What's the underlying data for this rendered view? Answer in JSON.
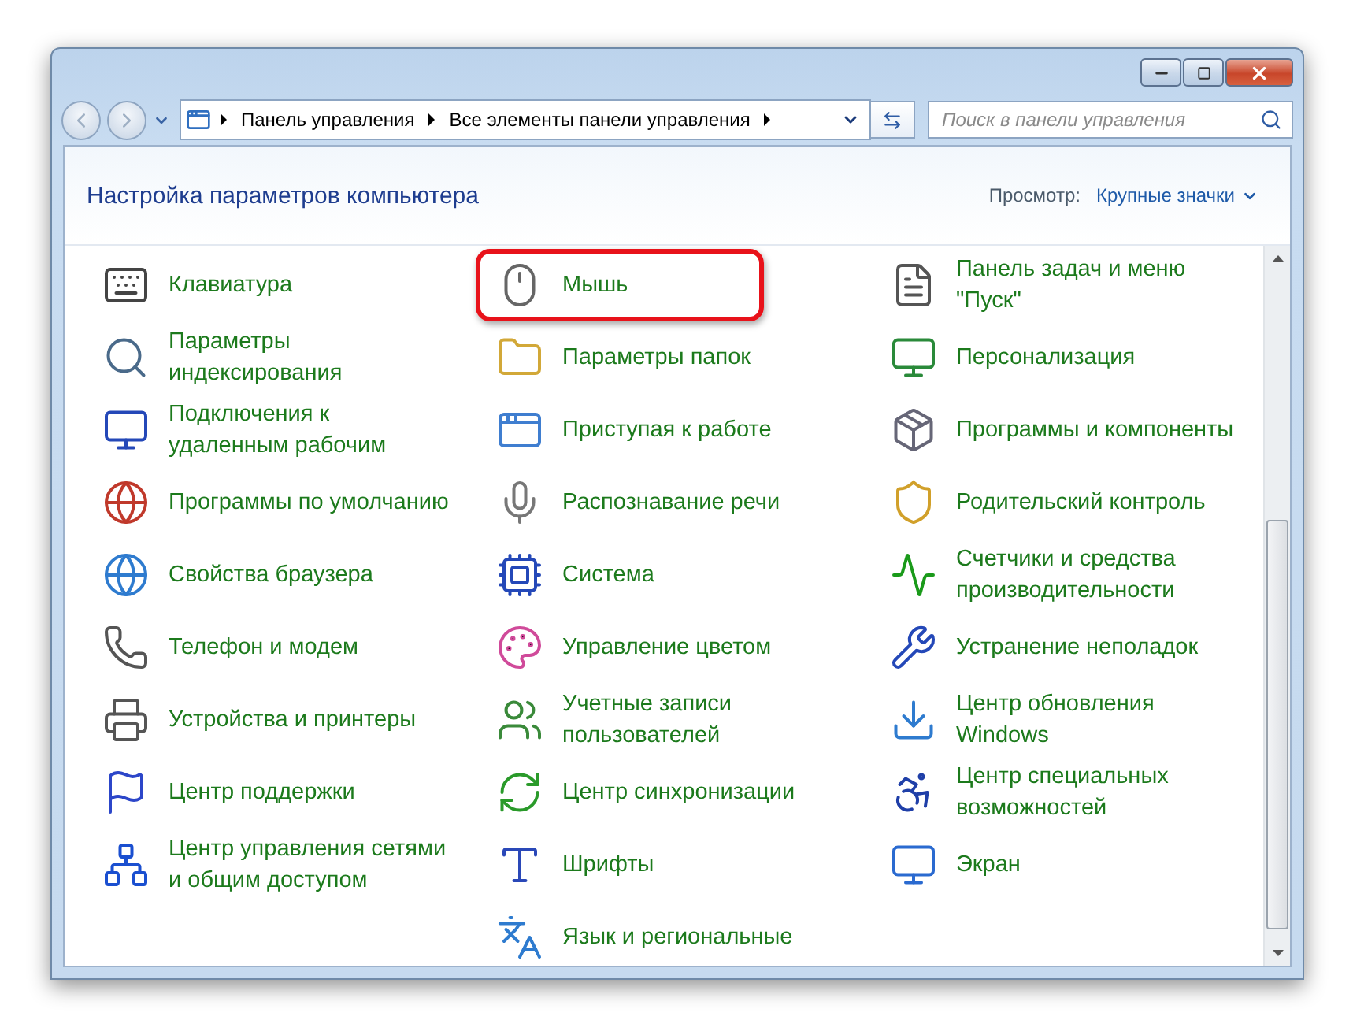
{
  "address_bar": {
    "path": [
      "Панель управления",
      "Все элементы панели управления"
    ]
  },
  "search": {
    "placeholder": "Поиск в панели управления"
  },
  "heading": "Настройка параметров компьютера",
  "view": {
    "label": "Просмотр:",
    "value": "Крупные значки"
  },
  "columns": [
    [
      {
        "label": "Клавиатура",
        "highlighted": false
      },
      {
        "label": "Параметры индексирования",
        "highlighted": false
      },
      {
        "label": "Подключения к удаленным рабочим",
        "highlighted": false
      },
      {
        "label": "Программы по умолчанию",
        "highlighted": false
      },
      {
        "label": "Свойства браузера",
        "highlighted": false
      },
      {
        "label": "Телефон и модем",
        "highlighted": false
      },
      {
        "label": "Устройства и принтеры",
        "highlighted": false
      },
      {
        "label": "Центр поддержки",
        "highlighted": false
      },
      {
        "label": "Центр управления сетями и общим доступом",
        "highlighted": false
      }
    ],
    [
      {
        "label": "Мышь",
        "highlighted": true
      },
      {
        "label": "Параметры папок",
        "highlighted": false
      },
      {
        "label": "Приступая к работе",
        "highlighted": false
      },
      {
        "label": "Распознавание речи",
        "highlighted": false
      },
      {
        "label": "Система",
        "highlighted": false
      },
      {
        "label": "Управление цветом",
        "highlighted": false
      },
      {
        "label": "Учетные записи пользователей",
        "highlighted": false
      },
      {
        "label": "Центр синхронизации",
        "highlighted": false
      },
      {
        "label": "Шрифты",
        "highlighted": false
      },
      {
        "label": "Язык и региональные",
        "highlighted": false
      }
    ],
    [
      {
        "label": "Панель задач и меню \"Пуск\"",
        "highlighted": false
      },
      {
        "label": "Персонализация",
        "highlighted": false
      },
      {
        "label": "Программы и компоненты",
        "highlighted": false
      },
      {
        "label": "Родительский контроль",
        "highlighted": false
      },
      {
        "label": "Счетчики и средства производительности",
        "highlighted": false
      },
      {
        "label": "Устранение неполадок",
        "highlighted": false
      },
      {
        "label": "Центр обновления Windows",
        "highlighted": false
      },
      {
        "label": "Центр специальных возможностей",
        "highlighted": false
      },
      {
        "label": "Экран",
        "highlighted": false
      }
    ]
  ]
}
